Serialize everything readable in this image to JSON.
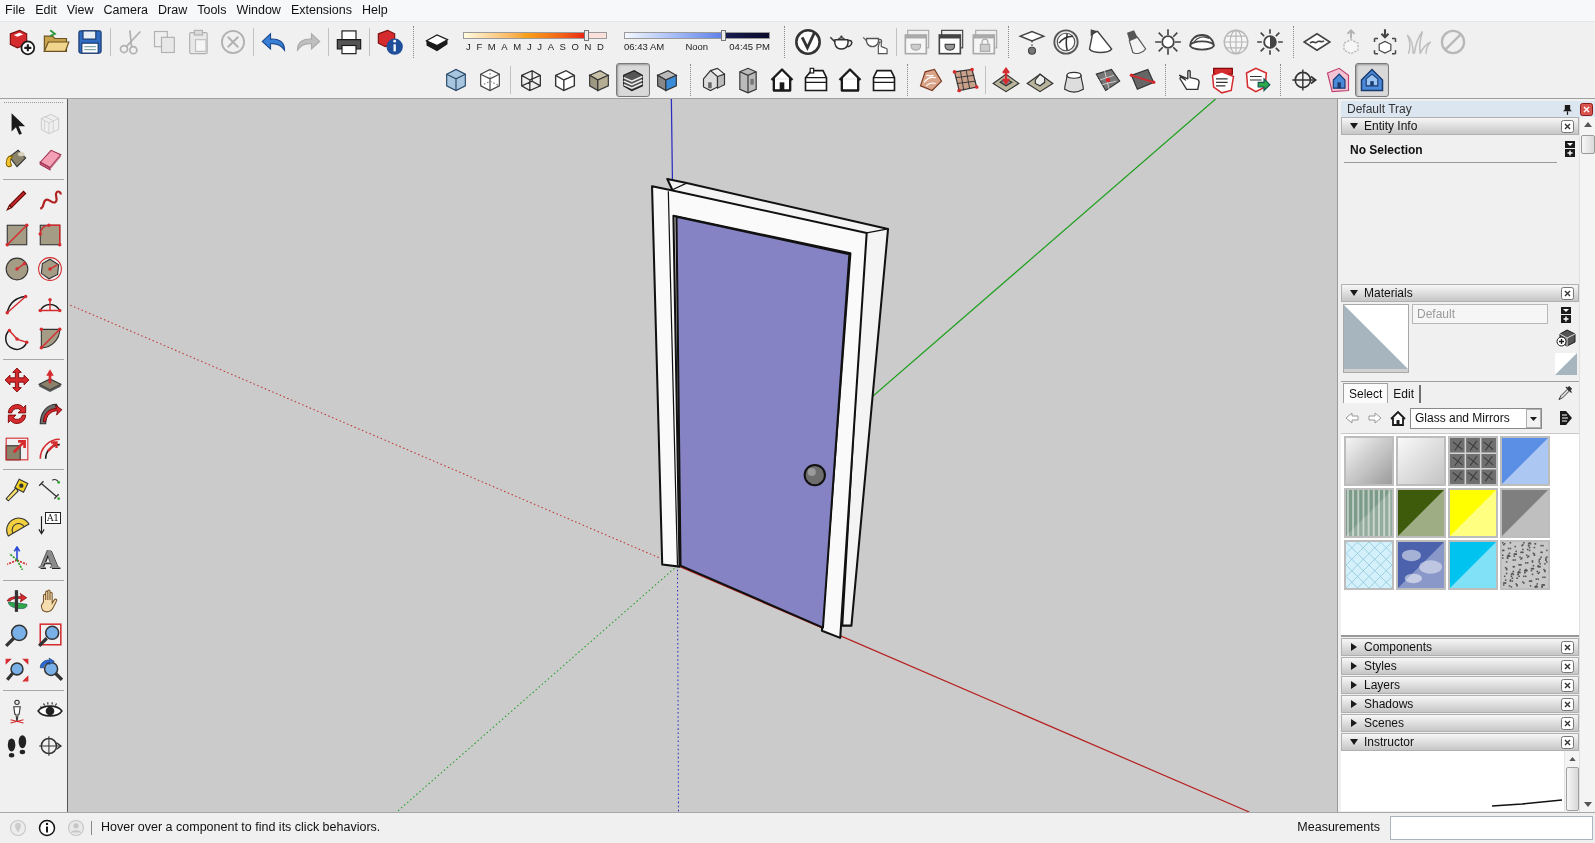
{
  "menu_bar": [
    "File",
    "Edit",
    "View",
    "Camera",
    "Draw",
    "Tools",
    "Window",
    "Extensions",
    "Help"
  ],
  "toolbar_row_1": [
    {
      "kind": "buttons",
      "groups": [
        {
          "buttons": [
            {
              "kind": "new",
              "disabled": false,
              "selected": false
            },
            {
              "kind": "open",
              "disabled": false,
              "selected": false
            },
            {
              "kind": "save",
              "disabled": false,
              "selected": false
            }
          ]
        },
        {
          "buttons": [
            {
              "kind": "cut",
              "disabled": true,
              "selected": false
            },
            {
              "kind": "copy",
              "disabled": true,
              "selected": false
            },
            {
              "kind": "paste",
              "disabled": true,
              "selected": false
            },
            {
              "kind": "erase",
              "disabled": true,
              "selected": false
            }
          ]
        },
        {
          "buttons": [
            {
              "kind": "undo",
              "disabled": false,
              "selected": false
            },
            {
              "kind": "redo",
              "disabled": true,
              "selected": false
            }
          ]
        },
        {
          "buttons": [
            {
              "kind": "print",
              "disabled": false,
              "selected": false
            }
          ]
        },
        {
          "buttons": [
            {
              "kind": "model_info",
              "disabled": false,
              "selected": false
            }
          ]
        }
      ]
    },
    {
      "kind": "shadows",
      "toggle": {
        "kind": "shadow",
        "disabled": false,
        "selected": false
      },
      "date_slider": {
        "months": [
          "J",
          "F",
          "M",
          "A",
          "M",
          "J",
          "J",
          "A",
          "S",
          "O",
          "N",
          "D"
        ],
        "level": 0.86
      },
      "time_slider": {
        "start": "06:43 AM",
        "middle": "Noon",
        "end": "04:45 PM",
        "level": 0.68
      }
    },
    {
      "kind": "buttons",
      "groups": [
        {
          "buttons": [
            {
              "kind": "v_logo",
              "disabled": false,
              "selected": false
            },
            {
              "kind": "teapot",
              "disabled": false,
              "selected": false
            },
            {
              "kind": "teapot_hand",
              "disabled": false,
              "selected": false
            }
          ]
        },
        {
          "buttons": [
            {
              "kind": "window_teapot",
              "disabled": true,
              "selected": false
            },
            {
              "kind": "window_teapot",
              "disabled": false,
              "selected": false
            },
            {
              "kind": "window_lock",
              "disabled": true,
              "selected": false
            }
          ]
        }
      ]
    },
    {
      "kind": "buttons",
      "groups": [
        {
          "buttons": [
            {
              "kind": "plane_light",
              "disabled": false,
              "selected": false
            },
            {
              "kind": "sphere_light",
              "disabled": false,
              "selected": false
            },
            {
              "kind": "cone_light",
              "disabled": false,
              "selected": false
            },
            {
              "kind": "spot_light",
              "disabled": false,
              "selected": false
            },
            {
              "kind": "omni_light",
              "disabled": false,
              "selected": false
            },
            {
              "kind": "dome_light",
              "disabled": false,
              "selected": false
            },
            {
              "kind": "globe",
              "disabled": true,
              "selected": false
            },
            {
              "kind": "half_sun",
              "disabled": false,
              "selected": false
            }
          ]
        }
      ]
    },
    {
      "kind": "buttons",
      "groups": [
        {
          "buttons": [
            {
              "kind": "wave_plane",
              "disabled": false,
              "selected": false
            },
            {
              "kind": "box_up",
              "disabled": true,
              "selected": false
            },
            {
              "kind": "box_down",
              "disabled": false,
              "selected": false
            },
            {
              "kind": "grass",
              "disabled": true,
              "selected": false
            },
            {
              "kind": "no_entry",
              "disabled": true,
              "selected": false
            }
          ]
        }
      ]
    }
  ],
  "toolbar_row_2": [
    {
      "kind": "buttons",
      "groups": [
        {
          "buttons": [
            {
              "kind": "xray",
              "disabled": false,
              "selected": false
            },
            {
              "kind": "back_edges",
              "disabled": false,
              "selected": false
            }
          ]
        },
        {
          "buttons": [
            {
              "kind": "wireframe",
              "disabled": false,
              "selected": false
            },
            {
              "kind": "hidden_line",
              "disabled": false,
              "selected": false
            },
            {
              "kind": "shaded",
              "disabled": false,
              "selected": false
            },
            {
              "kind": "textured",
              "disabled": false,
              "selected": true
            },
            {
              "kind": "monochrome",
              "disabled": false,
              "selected": false
            }
          ]
        }
      ]
    },
    {
      "kind": "buttons",
      "groups": [
        {
          "buttons": [
            {
              "kind": "view_iso",
              "disabled": false,
              "selected": false
            },
            {
              "kind": "view_top",
              "disabled": false,
              "selected": false
            },
            {
              "kind": "view_front",
              "disabled": false,
              "selected": false
            },
            {
              "kind": "view_right",
              "disabled": false,
              "selected": false
            },
            {
              "kind": "view_back",
              "disabled": false,
              "selected": false
            },
            {
              "kind": "view_left",
              "disabled": false,
              "selected": false
            }
          ]
        }
      ]
    },
    {
      "kind": "buttons",
      "groups": [
        {
          "buttons": [
            {
              "kind": "contours",
              "disabled": false,
              "selected": false
            },
            {
              "kind": "grid_mesh",
              "disabled": false,
              "selected": false
            }
          ]
        },
        {
          "buttons": [
            {
              "kind": "smoove",
              "disabled": false,
              "selected": false
            },
            {
              "kind": "stamp",
              "disabled": false,
              "selected": false
            },
            {
              "kind": "drape",
              "disabled": false,
              "selected": false
            },
            {
              "kind": "add_detail",
              "disabled": false,
              "selected": false
            },
            {
              "kind": "flip_edge",
              "disabled": false,
              "selected": false
            }
          ]
        }
      ]
    },
    {
      "kind": "buttons",
      "groups": [
        {
          "buttons": [
            {
              "kind": "interact",
              "disabled": false,
              "selected": false
            },
            {
              "kind": "dc_options",
              "disabled": false,
              "selected": false
            },
            {
              "kind": "dc_attributes",
              "disabled": false,
              "selected": false
            }
          ]
        }
      ]
    },
    {
      "kind": "buttons",
      "groups": [
        {
          "buttons": [
            {
              "kind": "crosshair",
              "disabled": false,
              "selected": false
            },
            {
              "kind": "section_house",
              "disabled": false,
              "selected": false
            },
            {
              "kind": "house_cube",
              "disabled": false,
              "selected": true
            }
          ]
        }
      ]
    }
  ],
  "tool_palette": [
    {
      "buttons": [
        {
          "kind": "select",
          "disabled": false,
          "selected": false
        },
        {
          "kind": "component",
          "disabled": true,
          "selected": false
        },
        {
          "kind": "paint",
          "disabled": false,
          "selected": false
        },
        {
          "kind": "eraser",
          "disabled": false,
          "selected": false
        }
      ]
    },
    {
      "buttons": [
        {
          "kind": "pencil",
          "disabled": false,
          "selected": false
        },
        {
          "kind": "freehand",
          "disabled": false,
          "selected": false
        },
        {
          "kind": "rectangle",
          "disabled": false,
          "selected": false
        },
        {
          "kind": "rotated_rectangle",
          "disabled": false,
          "selected": false
        },
        {
          "kind": "circle",
          "disabled": false,
          "selected": false
        },
        {
          "kind": "polygon",
          "disabled": false,
          "selected": false
        },
        {
          "kind": "arc",
          "disabled": false,
          "selected": false
        },
        {
          "kind": "arc_2pt",
          "disabled": false,
          "selected": false
        },
        {
          "kind": "arc_3pt",
          "disabled": false,
          "selected": false
        },
        {
          "kind": "pie",
          "disabled": false,
          "selected": false
        }
      ]
    },
    {
      "buttons": [
        {
          "kind": "move",
          "disabled": false,
          "selected": false
        },
        {
          "kind": "push_pull",
          "disabled": false,
          "selected": false
        },
        {
          "kind": "rotate",
          "disabled": false,
          "selected": false
        },
        {
          "kind": "follow_me",
          "disabled": false,
          "selected": false
        },
        {
          "kind": "scale",
          "disabled": false,
          "selected": false
        },
        {
          "kind": "offset",
          "disabled": false,
          "selected": false
        }
      ]
    },
    {
      "buttons": [
        {
          "kind": "tape",
          "disabled": false,
          "selected": false
        },
        {
          "kind": "dimension",
          "disabled": false,
          "selected": false
        },
        {
          "kind": "protractor",
          "disabled": false,
          "selected": false
        },
        {
          "kind": "text",
          "label": "A1",
          "disabled": false,
          "selected": false
        },
        {
          "kind": "axes",
          "disabled": false,
          "selected": false
        },
        {
          "kind": "text3d",
          "label": "A",
          "disabled": false,
          "selected": false
        }
      ]
    },
    {
      "buttons": [
        {
          "kind": "orbit",
          "disabled": false,
          "selected": false
        },
        {
          "kind": "pan",
          "disabled": false,
          "selected": false
        },
        {
          "kind": "zoom",
          "disabled": false,
          "selected": false
        },
        {
          "kind": "zoom_window",
          "disabled": false,
          "selected": false
        },
        {
          "kind": "zoom_extents",
          "disabled": false,
          "selected": false
        },
        {
          "kind": "previous",
          "disabled": false,
          "selected": false
        }
      ]
    },
    {
      "buttons": [
        {
          "kind": "position_camera",
          "disabled": false,
          "selected": false
        },
        {
          "kind": "look_around",
          "disabled": false,
          "selected": false
        },
        {
          "kind": "walk",
          "disabled": false,
          "selected": false
        },
        {
          "kind": "section_plane",
          "disabled": false,
          "selected": false
        }
      ]
    }
  ],
  "tray": {
    "title": "Default Tray",
    "panels": [
      {
        "kind": "entity_info",
        "title": "Entity Info",
        "expanded": true,
        "selection": "No Selection"
      },
      {
        "kind": "materials",
        "title": "Materials",
        "expanded": true,
        "material_name": "Default",
        "tabs": [
          {
            "label": "Select",
            "selected": true
          },
          {
            "label": "Edit",
            "selected": false
          }
        ],
        "collection": "Glass and Mirrors",
        "swatches": [
          {
            "kind": "gradient",
            "color": "#9c9c9c",
            "selected": false
          },
          {
            "kind": "gradient",
            "color": "#c4c4c4",
            "selected": false
          },
          {
            "kind": "tiles",
            "color": "#6f6f6f",
            "selected": false
          },
          {
            "kind": "split",
            "color": "#5b8fe6",
            "selected": false
          },
          {
            "kind": "stripes",
            "color": "#7c9a88",
            "selected": false
          },
          {
            "kind": "split",
            "color": "#3e5b0b",
            "selected": false
          },
          {
            "kind": "split",
            "color": "#ffff00",
            "selected": false
          },
          {
            "kind": "split",
            "color": "#7f7f7f",
            "selected": false
          },
          {
            "kind": "grid",
            "color": "#d4f0fb",
            "selected": false
          },
          {
            "kind": "clouds",
            "color": "#4c62ad",
            "selected": false
          },
          {
            "kind": "split",
            "color": "#00c3ef",
            "selected": false
          },
          {
            "kind": "noise",
            "color": "#c8c8c8",
            "selected": false
          }
        ]
      },
      {
        "kind": "plain",
        "title": "Components",
        "expanded": false
      },
      {
        "kind": "plain",
        "title": "Styles",
        "expanded": false
      },
      {
        "kind": "plain",
        "title": "Layers",
        "expanded": false
      },
      {
        "kind": "plain",
        "title": "Shadows",
        "expanded": false
      },
      {
        "kind": "plain",
        "title": "Scenes",
        "expanded": false
      },
      {
        "kind": "instructor",
        "title": "Instructor",
        "expanded": true
      }
    ]
  },
  "status_bar": {
    "icons": [
      {
        "kind": "status_location",
        "disabled": true
      },
      {
        "kind": "status_info",
        "disabled": false
      },
      {
        "kind": "status_user",
        "disabled": true
      }
    ],
    "hint": "Hover over a component to find its click behaviors.",
    "measurements_label": "Measurements"
  }
}
